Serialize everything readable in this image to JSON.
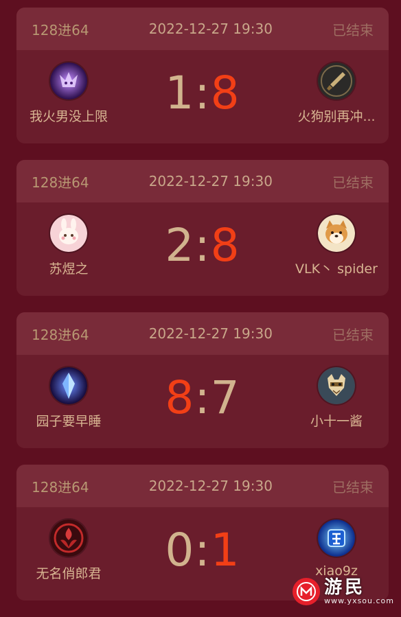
{
  "matches": [
    {
      "round": "128进64",
      "time": "2022-12-27 19:30",
      "status": "已结束",
      "left": {
        "name": "我火男没上限",
        "avatar_icon": "purple-fox-spirit-icon",
        "score": "1"
      },
      "right": {
        "name": "火狗别再冲...",
        "avatar_icon": "dagger-icon",
        "score": "8"
      },
      "colon": ":",
      "winner": "right"
    },
    {
      "round": "128进64",
      "time": "2022-12-27 19:30",
      "status": "已结束",
      "left": {
        "name": "苏煜之",
        "avatar_icon": "bunny-icon",
        "score": "2"
      },
      "right": {
        "name": "VLK丶 spider",
        "avatar_icon": "shiba-dog-icon",
        "score": "8"
      },
      "colon": ":",
      "winner": "right"
    },
    {
      "round": "128进64",
      "time": "2022-12-27 19:30",
      "status": "已结束",
      "left": {
        "name": "园子要早睡",
        "avatar_icon": "crystal-icon",
        "score": "8"
      },
      "right": {
        "name": "小十一酱",
        "avatar_icon": "cat-mask-icon",
        "score": "7"
      },
      "colon": ":",
      "winner": "left"
    },
    {
      "round": "128进64",
      "time": "2022-12-27 19:30",
      "status": "已结束",
      "left": {
        "name": "无名俏郎君",
        "avatar_icon": "red-emblem-icon",
        "score": "0"
      },
      "right": {
        "name": "xiao9z",
        "avatar_icon": "strong-badge-icon",
        "score": "1"
      },
      "colon": ":",
      "winner": "right"
    }
  ],
  "watermark": {
    "title": "游民",
    "url": "www.yxsou.com",
    "logo_letter": "M"
  },
  "colors": {
    "background": "#5e0f20",
    "card": "#6a1d2c",
    "header": "#792b39",
    "winner_score": "#f23f16",
    "loser_score": "#d1b38e"
  }
}
